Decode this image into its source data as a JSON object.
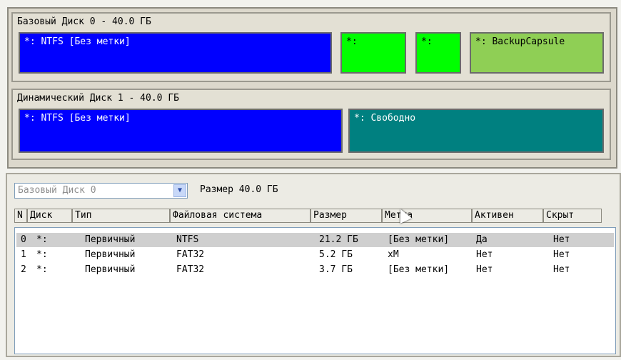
{
  "disk0": {
    "title": "Базовый Диск 0 - 40.0 ГБ",
    "partitions": [
      {
        "label": "*: NTFS [Без метки]",
        "color": "#0000ff"
      },
      {
        "label": "*:",
        "color": "#00ff00"
      },
      {
        "label": "*:",
        "color": "#00ff00"
      },
      {
        "label": "*: BackupCapsule",
        "color": "#8fcf55"
      }
    ]
  },
  "disk1": {
    "title": "Динамический Диск 1 - 40.0 ГБ",
    "partitions": [
      {
        "label": "*: NTFS [Без метки]",
        "color": "#0000ff"
      },
      {
        "label": "*: Свободно",
        "color": "#008080"
      }
    ]
  },
  "selector": {
    "value": "Базовый Диск 0",
    "size_label": "Размер 40.0 ГБ"
  },
  "table": {
    "columns": [
      "N",
      "Диск",
      "Тип",
      "Файловая система",
      "Размер",
      "Метка",
      "Активен",
      "Скрыт"
    ],
    "rows": [
      {
        "n": "0",
        "disk": "*:",
        "type": "Первичный",
        "fs": "NTFS",
        "size": "21.2 ГБ",
        "label": "[Без метки]",
        "active": "Да",
        "hidden": "Нет"
      },
      {
        "n": "1",
        "disk": "*:",
        "type": "Первичный",
        "fs": "FAT32",
        "size": "5.2 ГБ",
        "label": "xM",
        "active": "Нет",
        "hidden": "Нет"
      },
      {
        "n": "2",
        "disk": "*:",
        "type": "Первичный",
        "fs": "FAT32",
        "size": "3.7 ГБ",
        "label": "[Без метки]",
        "active": "Нет",
        "hidden": "Нет"
      }
    ]
  }
}
